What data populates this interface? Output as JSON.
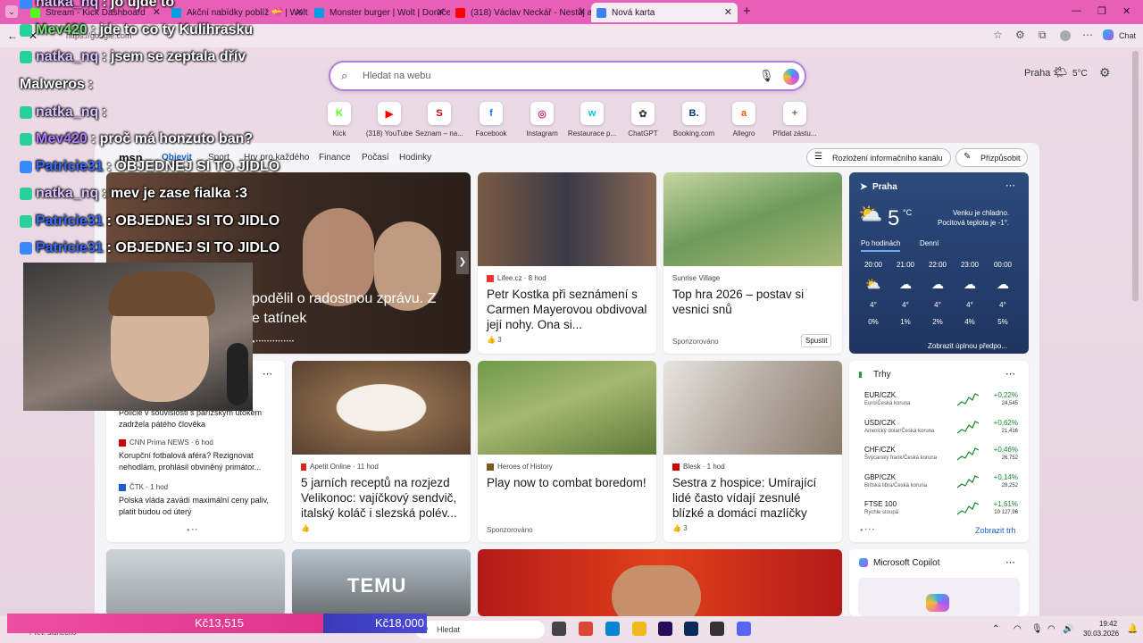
{
  "tabs": [
    {
      "label": "Stream - Kick Dashboard",
      "color": "#53fc18"
    },
    {
      "label": "Akční nabídky poblíž 💝 | Wolt",
      "color": "#009de0"
    },
    {
      "label": "Monster burger | Wolt | Doručení",
      "color": "#009de0"
    },
    {
      "label": "(318) Václav Neckář - Nestůj a po",
      "color": "#ff0000"
    },
    {
      "label": "Nová karta",
      "color": "#3b82f6"
    }
  ],
  "address": {
    "url": "https://google.com",
    "chat_label": "Chat"
  },
  "chat": [
    {
      "user": "natka_nq",
      "msg": ": jo ujde to",
      "color": "#d9c0ff"
    },
    {
      "user": "Mev420",
      "msg": ": jde to co ty Kulihrasku",
      "color": "#7ee07e"
    },
    {
      "user": "natka_nq",
      "msg": ": jsem se zeptala dřív",
      "color": "#d9c0ff"
    },
    {
      "user": "Malweros",
      "msg": ":",
      "color": "#ffffff"
    },
    {
      "user": "natka_nq",
      "msg": ":",
      "color": "#d9c0ff"
    },
    {
      "user": "Mev420",
      "msg": ": proč má honzuto ban?",
      "color": "#b07cff"
    },
    {
      "user": "Patricie31",
      "msg": ": OBJEDNEJ SI TO JIDLO",
      "color": "#3b6cff"
    },
    {
      "user": "natka_nq",
      "msg": ": mev je zase fialka :3",
      "color": "#d9c0ff"
    },
    {
      "user": "Patricie31",
      "msg": ": OBJEDNEJ SI TO JIDLO",
      "color": "#3b6cff"
    },
    {
      "user": "Patricie31",
      "msg": ": OBJEDNEJ SI TO JIDLO",
      "color": "#3b6cff"
    }
  ],
  "search": {
    "placeholder": "Hledat na webu"
  },
  "header_right": {
    "city": "Praha",
    "temp": "5°C"
  },
  "quicklinks": [
    {
      "label": "Kick",
      "glyph": "K",
      "color": "#53fc18"
    },
    {
      "label": "(318) YouTube",
      "glyph": "▶",
      "color": "#ff0000"
    },
    {
      "label": "Seznam – na...",
      "glyph": "S",
      "color": "#cc0000"
    },
    {
      "label": "Facebook",
      "glyph": "f",
      "color": "#1877f2"
    },
    {
      "label": "Instagram",
      "glyph": "◎",
      "color": "#d62976"
    },
    {
      "label": "Restaurace p...",
      "glyph": "w",
      "color": "#00c2e8"
    },
    {
      "label": "ChatGPT",
      "glyph": "✿",
      "color": "#444444"
    },
    {
      "label": "Booking.com",
      "glyph": "B.",
      "color": "#003580"
    },
    {
      "label": "Allegro",
      "glyph": "a",
      "color": "#ff5a00"
    },
    {
      "label": "Přidat zástu...",
      "glyph": "+",
      "color": "#666666"
    }
  ],
  "feed_nav": {
    "logo": "msn",
    "tabs": [
      "Objevit",
      "Sport",
      "Hry pro každého",
      "Finance",
      "Počasí",
      "Hodinky"
    ],
    "layout_btn": "Rozložení informačního kanálu",
    "customize_btn": "Přizpůsobit"
  },
  "hero": {
    "title": "podělil o radostnou zprávu. Z",
    "title2": "e tatínek"
  },
  "cards": [
    {
      "source": "Lifee.cz · 8 hod",
      "title": "Petr Kostka při seznámení s Carmen Mayerovou obdivoval její nohy. Ona si...",
      "likes": "3"
    },
    {
      "source": "Sunrise Village",
      "title": "Top hra 2026 – postav si vesnici snů",
      "meta": "Sponzorováno",
      "action": "Spustit"
    },
    {
      "source": "Apetit Online · 11 hod",
      "title": "5 jarních receptů na rozjezd Velikonoc: vajíčkový sendvič, italský koláč i slezská polév..."
    },
    {
      "source": "Heroes of History",
      "title": "Play now to combat boredom!",
      "meta": "Sponzorováno"
    },
    {
      "source": "Blesk · 1 hod",
      "title": "Sestra z hospice: Umírající lidé často vídají zesnulé blízké a domácí mazlíčky",
      "likes": "3"
    }
  ],
  "left_list": [
    {
      "title": "Policie v souvislosti s pařížským útokem zadržela pátého člověka"
    },
    {
      "source": "CNN Prima NEWS · 6 hod",
      "title": "Korupční fotbalová aféra? Rezignovat nehodlám, prohlásil obviněný primátor..."
    },
    {
      "source": "ČTK · 1 hod",
      "title": "Polská vláda zavádí maximální ceny paliv, platit budou od úterý"
    }
  ],
  "weather": {
    "city": "Praha",
    "temp": "5",
    "unit": "°C",
    "desc": "Venku je chladno.",
    "feels": "Pocitová teplota je -1°.",
    "tab1": "Po hodinách",
    "tab2": "Denní",
    "hours": [
      {
        "t": "20:00",
        "v": "4°",
        "p": "0%"
      },
      {
        "t": "21:00",
        "v": "4°",
        "p": "1%"
      },
      {
        "t": "22:00",
        "v": "4°",
        "p": "2%"
      },
      {
        "t": "23:00",
        "v": "4°",
        "p": "4%"
      },
      {
        "t": "00:00",
        "v": "4°",
        "p": "5%"
      }
    ],
    "more": "Zobrazit úplnou předpo..."
  },
  "markets": {
    "title": "Trhy",
    "more": "Zobrazit trh",
    "rows": [
      {
        "sym": "EUR/CZK",
        "name": "Euro/Česká koruna",
        "chg": "+0,22%",
        "val": "24,545"
      },
      {
        "sym": "USD/CZK",
        "name": "Americký dolar/Česká koruna",
        "chg": "+0,62%",
        "val": "21,416"
      },
      {
        "sym": "CHF/CZK",
        "name": "Švýcarský frank/Česká koruna",
        "chg": "+0,46%",
        "val": "26,752"
      },
      {
        "sym": "GBP/CZK",
        "name": "Britská libra/Česká koruna",
        "chg": "+0,14%",
        "val": "28,252"
      },
      {
        "sym": "FTSE 100",
        "name": "Rychle stoupá",
        "chg": "+1,61%",
        "val": "10 127,96"
      }
    ]
  },
  "copilot": {
    "title": "Microsoft Copilot"
  },
  "bottom_tiles": {
    "temu": "TEMU"
  },
  "taskbar": {
    "left_text": "Prev. slunečno",
    "search": "Hledat",
    "time": "19:42",
    "date": "30.03.2026",
    "money1": "Kč13,515",
    "money2": "Kč18,000"
  }
}
